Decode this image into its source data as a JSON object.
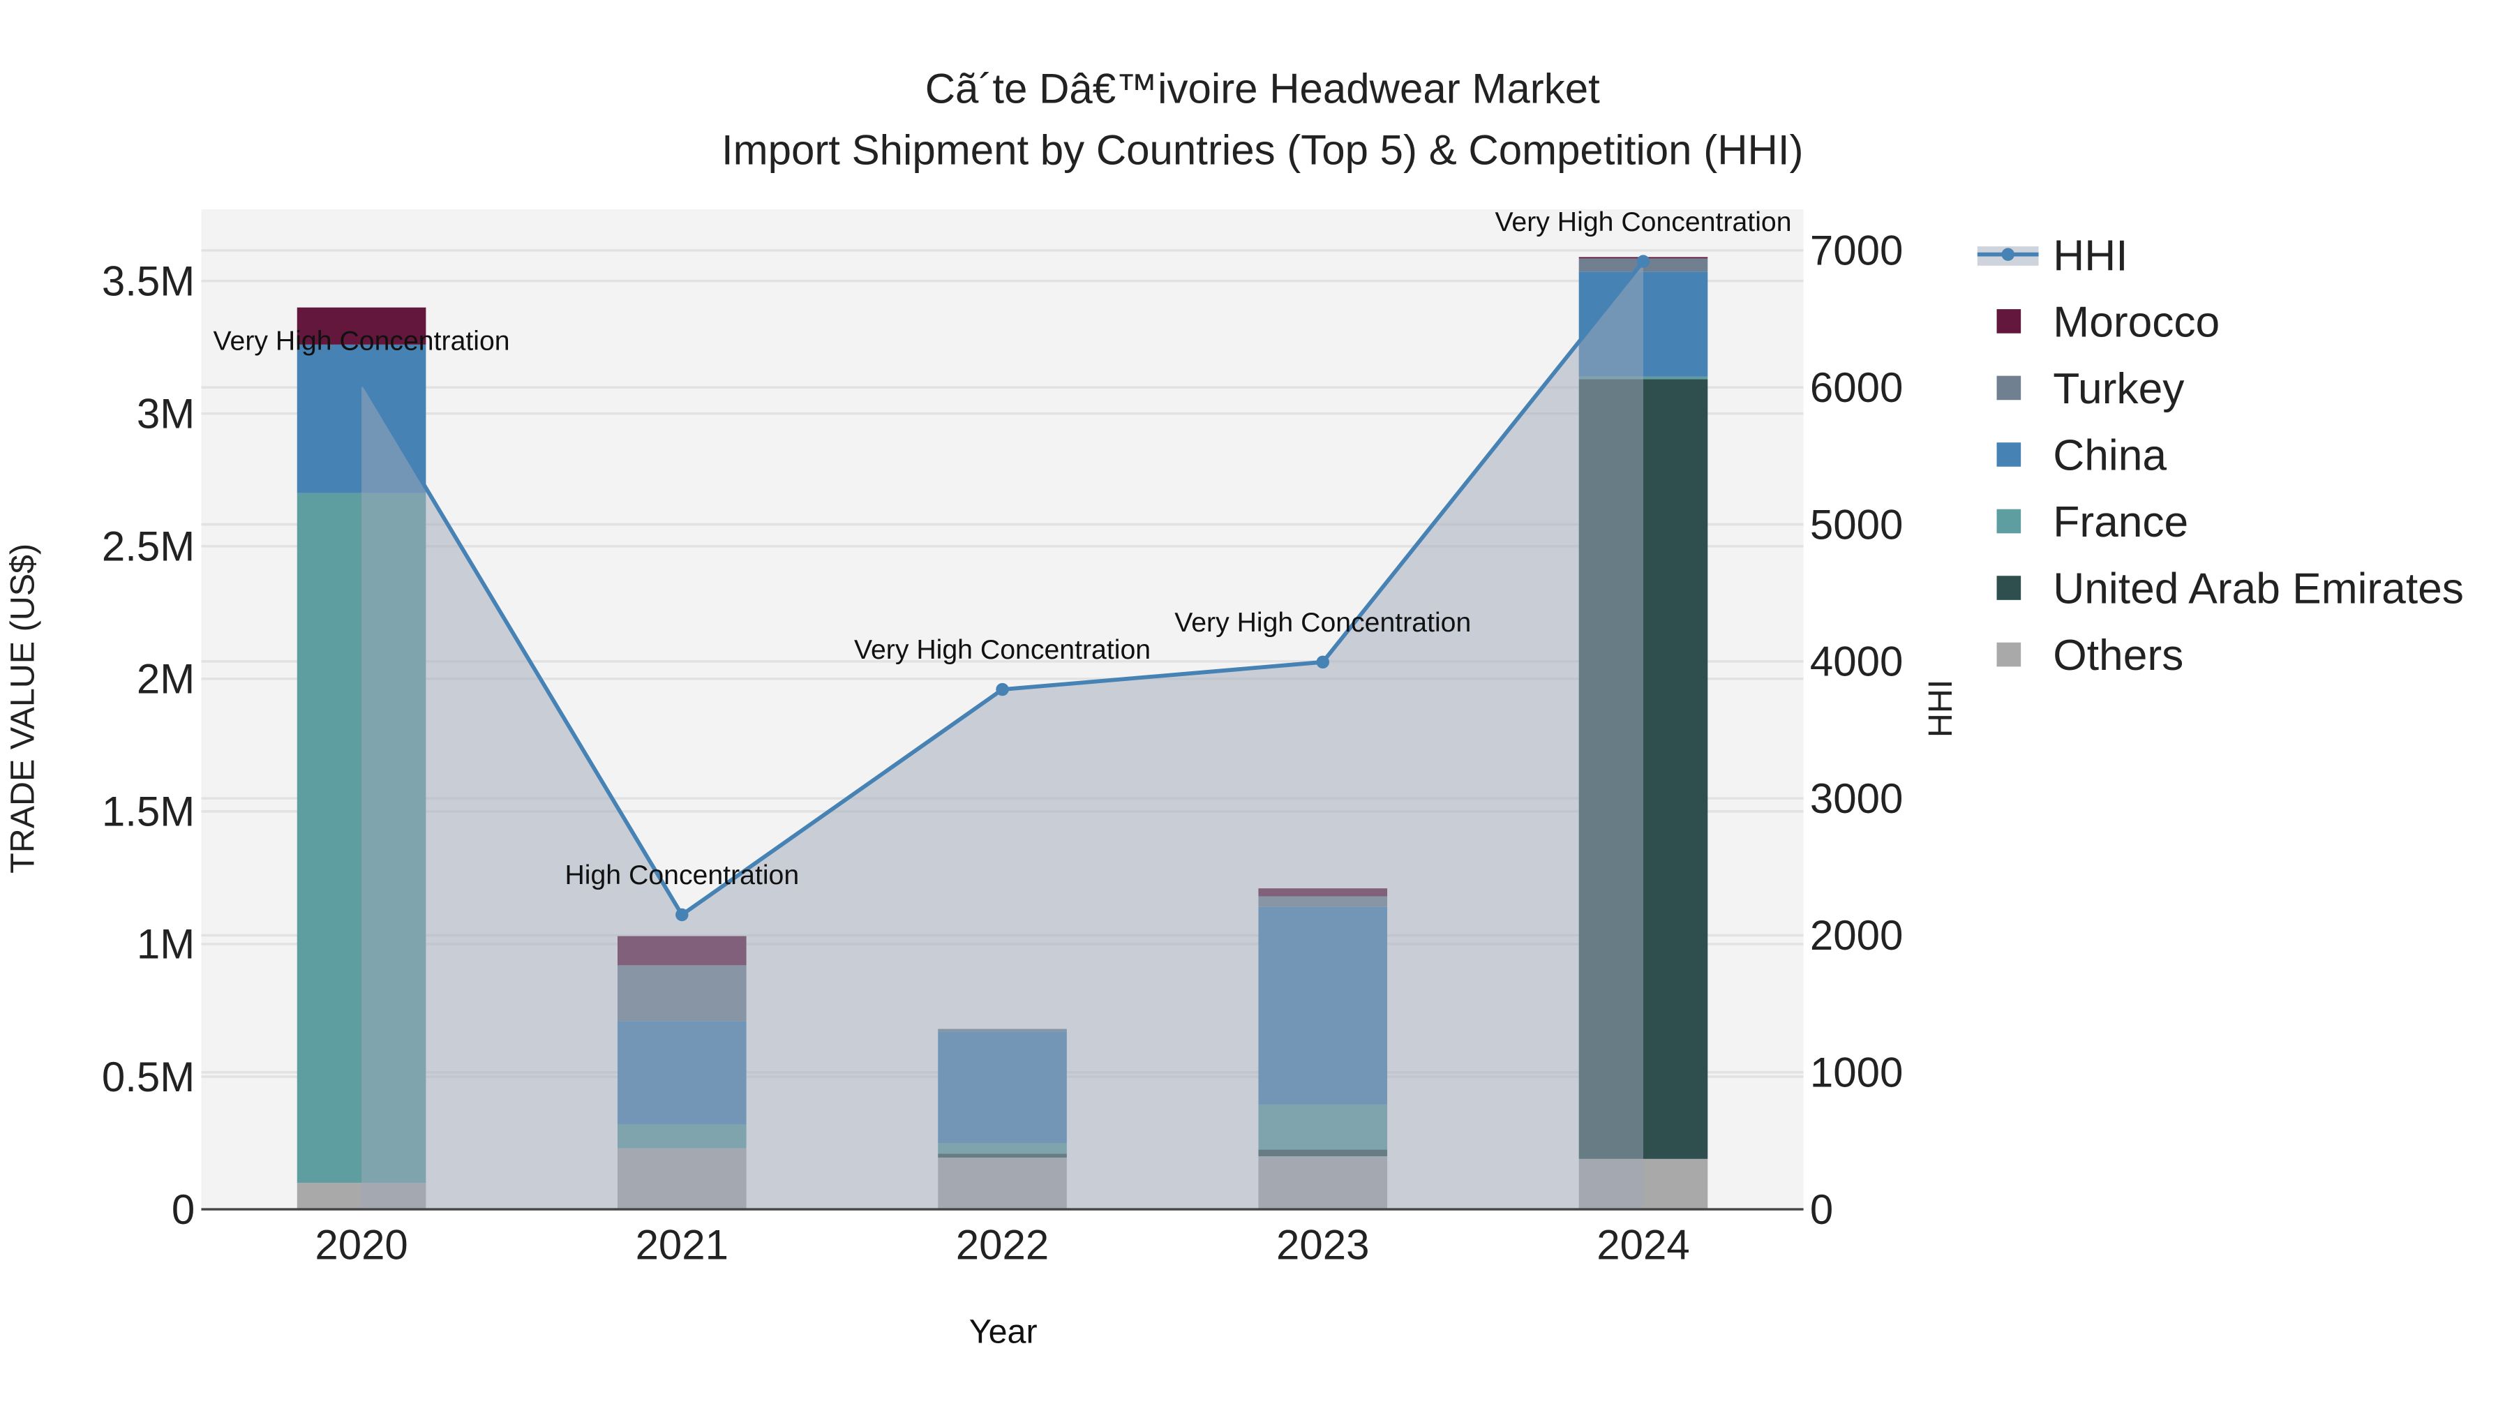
{
  "chart_data": {
    "type": "bar",
    "title": "Cã´te Dâ€™ivoire Headwear Market",
    "subtitle": "Import Shipment by Countries (Top 5) & Competition (HHI)",
    "xlabel": "Year",
    "ylabel": "TRADE VALUE (US$)",
    "y2label": "HHI",
    "categories": [
      "2020",
      "2021",
      "2022",
      "2023",
      "2024"
    ],
    "ylim": [
      0,
      3770000
    ],
    "y2lim": [
      0,
      7300
    ],
    "yticks": [
      {
        "v": 0,
        "label": "0"
      },
      {
        "v": 500000,
        "label": "0.5M"
      },
      {
        "v": 1000000,
        "label": "1M"
      },
      {
        "v": 1500000,
        "label": "1.5M"
      },
      {
        "v": 2000000,
        "label": "2M"
      },
      {
        "v": 2500000,
        "label": "2.5M"
      },
      {
        "v": 3000000,
        "label": "3M"
      },
      {
        "v": 3500000,
        "label": "3.5M"
      }
    ],
    "y2ticks": [
      {
        "v": 0,
        "label": "0"
      },
      {
        "v": 1000,
        "label": "1000"
      },
      {
        "v": 2000,
        "label": "2000"
      },
      {
        "v": 3000,
        "label": "3000"
      },
      {
        "v": 4000,
        "label": "4000"
      },
      {
        "v": 5000,
        "label": "5000"
      },
      {
        "v": 6000,
        "label": "6000"
      },
      {
        "v": 7000,
        "label": "7000"
      }
    ],
    "grid": true,
    "legend_position": "right",
    "stacked": true,
    "series": [
      {
        "name": "Others",
        "color": "#a9a9a9",
        "values": [
          100000,
          230000,
          195000,
          200000,
          190000
        ]
      },
      {
        "name": "United Arab Emirates",
        "color": "#2f4f4f",
        "values": [
          0,
          0,
          15000,
          25000,
          2940000
        ]
      },
      {
        "name": "France",
        "color": "#5f9ea0",
        "values": [
          2600000,
          90000,
          40000,
          170000,
          10000
        ]
      },
      {
        "name": "China",
        "color": "#4682b4",
        "values": [
          560000,
          390000,
          420000,
          745000,
          395000
        ]
      },
      {
        "name": "Turkey",
        "color": "#708090",
        "values": [
          0,
          210000,
          10000,
          40000,
          50000
        ]
      },
      {
        "name": "Morocco",
        "color": "#63173c",
        "values": [
          140000,
          110000,
          0,
          30000,
          5000
        ]
      }
    ],
    "legend_order": [
      "Morocco",
      "Turkey",
      "China",
      "France",
      "United Arab Emirates",
      "Others"
    ],
    "hhi": {
      "name": "HHI",
      "color": "#4682b4",
      "values": [
        6050,
        2150,
        3795,
        3995,
        6920
      ],
      "annotations": [
        "Very High Concentration",
        "High Concentration",
        "Very High Concentration",
        "Very High Concentration",
        "Very High Concentration"
      ]
    }
  }
}
